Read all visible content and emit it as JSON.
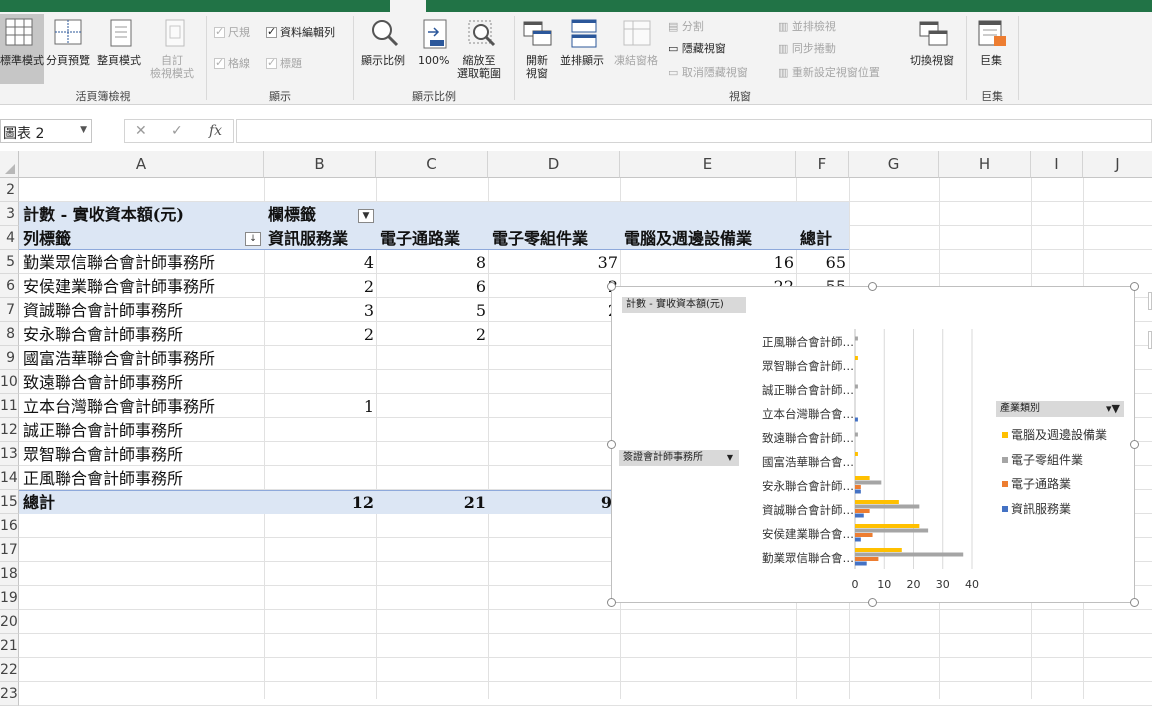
{
  "ribbon": {
    "groups": {
      "workbook_views": "活頁簿檢視",
      "show": "顯示",
      "zoom": "顯示比例",
      "window": "視窗",
      "macros": "巨集"
    },
    "normal_label": "標準模式",
    "page_break_label": "分頁預覽",
    "page_layout_label": "整頁模式",
    "custom_views_label": "自訂\n檢視模式",
    "ruler_label": "尺規",
    "formula_bar_label": "資料編輯列",
    "gridlines_label": "格線",
    "headings_label": "標題",
    "zoom_label": "顯示比例",
    "zoom100_label": "100%",
    "zoom_selection_label": "縮放至\n選取範圍",
    "new_window_label": "開新\n視窗",
    "arrange_all_label": "並排顯示",
    "freeze_panes_label": "凍結窗格",
    "split_label": "分割",
    "hide_label": "隱藏視窗",
    "unhide_label": "取消隱藏視窗",
    "view_side_label": "並排檢視",
    "sync_scroll_label": "同步捲動",
    "reset_position_label": "重新設定視窗位置",
    "switch_windows_label": "切換視窗",
    "macros_label": "巨集"
  },
  "formula_bar": {
    "name_box": "圖表 2",
    "fx": "fx",
    "cancel": "✕",
    "enter": "✓",
    "content": ""
  },
  "columns": [
    "A",
    "B",
    "C",
    "D",
    "E",
    "F",
    "G",
    "H",
    "I",
    "J"
  ],
  "rows": [
    "2",
    "3",
    "4",
    "5",
    "6",
    "7",
    "8",
    "9",
    "10",
    "11",
    "12",
    "13",
    "14",
    "15",
    "16",
    "17",
    "18",
    "19",
    "20",
    "21",
    "22",
    "23"
  ],
  "pivot": {
    "title": "計數 - 實收資本額(元)",
    "col_field": "欄標籤",
    "row_field": "列標籤",
    "headers": [
      "資訊服務業",
      "電子通路業",
      "電子零組件業",
      "電腦及週邊設備業",
      "總計"
    ],
    "rows": [
      {
        "name": "勤業眾信聯合會計師事務所",
        "v": [
          "4",
          "8",
          "37",
          "16",
          "65"
        ]
      },
      {
        "name": "安侯建業聯合會計師事務所",
        "v": [
          "2",
          "6",
          "2",
          "22",
          "55"
        ]
      },
      {
        "name": "資誠聯合會計師事務所",
        "v": [
          "3",
          "5",
          "2",
          "",
          ""
        ]
      },
      {
        "name": "安永聯合會計師事務所",
        "v": [
          "2",
          "2",
          "",
          "",
          ""
        ]
      },
      {
        "name": "國富浩華聯合會計師事務所",
        "v": [
          "",
          "",
          "",
          "",
          ""
        ]
      },
      {
        "name": "致遠聯合會計師事務所",
        "v": [
          "",
          "",
          "",
          "",
          ""
        ]
      },
      {
        "name": "立本台灣聯合會計師事務所",
        "v": [
          "1",
          "",
          "",
          "",
          ""
        ]
      },
      {
        "name": "誠正聯合會計師事務所",
        "v": [
          "",
          "",
          "",
          "",
          ""
        ]
      },
      {
        "name": "眾智聯合會計師事務所",
        "v": [
          "",
          "",
          "",
          "",
          ""
        ]
      },
      {
        "name": "正風聯合會計師事務所",
        "v": [
          "",
          "",
          "",
          "",
          ""
        ]
      }
    ],
    "total_label": "總計",
    "totals": [
      "12",
      "21",
      "9",
      "",
      ""
    ]
  },
  "chart": {
    "value_chip": "計數 - 實收資本額(元)",
    "axis_chip": "簽證會計師事務所",
    "legend_chip": "產業類別"
  },
  "chart_data": {
    "type": "bar",
    "orientation": "horizontal",
    "categories": [
      "勤業眾信聯合會…",
      "安侯建業聯合會…",
      "資誠聯合會計師…",
      "安永聯合會計師…",
      "國富浩華聯合會…",
      "致遠聯合會計師…",
      "立本台灣聯合會…",
      "誠正聯合會計師…",
      "眾智聯合會計師…",
      "正風聯合會計師…"
    ],
    "series": [
      {
        "name": "資訊服務業",
        "color": "#4472c4",
        "values": [
          4,
          2,
          3,
          2,
          0,
          0,
          1,
          0,
          0,
          0
        ]
      },
      {
        "name": "電子通路業",
        "color": "#ed7d31",
        "values": [
          8,
          6,
          5,
          2,
          0,
          0,
          0,
          0,
          0,
          0
        ]
      },
      {
        "name": "電子零組件業",
        "color": "#a5a5a5",
        "values": [
          37,
          25,
          22,
          9,
          0,
          1,
          0,
          1,
          0,
          1
        ]
      },
      {
        "name": "電腦及週邊設備業",
        "color": "#ffc000",
        "values": [
          16,
          22,
          15,
          5,
          1,
          0,
          0,
          0,
          1,
          0
        ]
      }
    ],
    "xticks": [
      "0",
      "10",
      "20",
      "30",
      "40"
    ],
    "xlim": [
      0,
      40
    ],
    "grid": true,
    "legend_position": "right"
  }
}
